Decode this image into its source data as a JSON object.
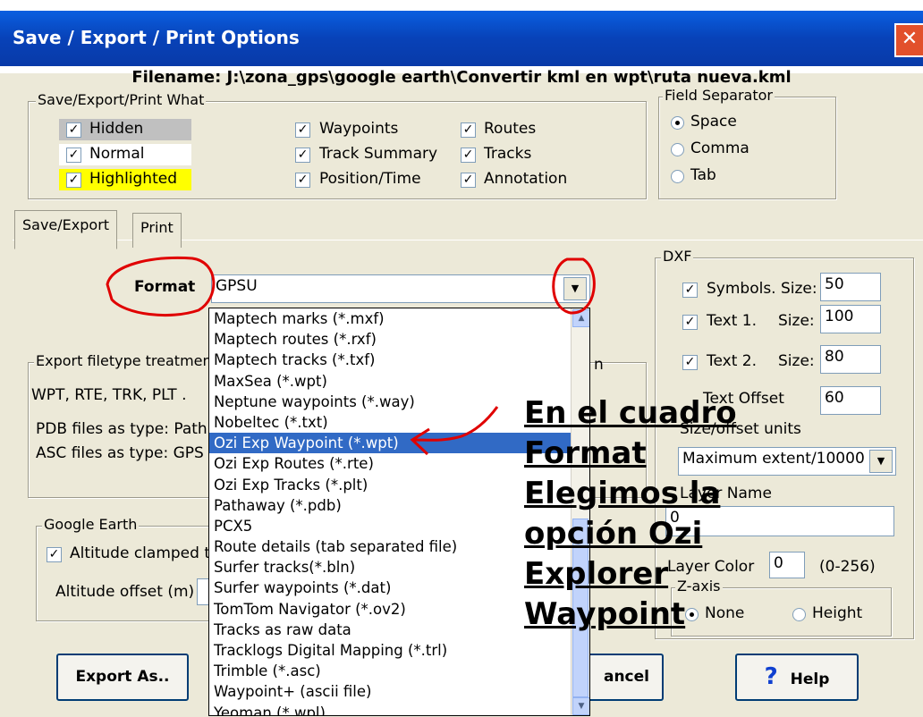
{
  "window": {
    "title": "Save / Export / Print Options",
    "close_glyph": "✕"
  },
  "filename": "Filename: J:\\zona_gps\\google earth\\Convertir kml en wpt\\ruta nueva.kml",
  "what_group": {
    "legend": "Save/Export/Print What",
    "col1": [
      {
        "label": "Hidden",
        "checked": true
      },
      {
        "label": "Normal",
        "checked": true
      },
      {
        "label": "Highlighted",
        "checked": true
      }
    ],
    "col2": [
      {
        "label": "Waypoints",
        "checked": true
      },
      {
        "label": "Track Summary",
        "checked": true
      },
      {
        "label": "Position/Time",
        "checked": true
      }
    ],
    "col3": [
      {
        "label": "Routes",
        "checked": true
      },
      {
        "label": "Tracks",
        "checked": true
      },
      {
        "label": "Annotation",
        "checked": true
      }
    ]
  },
  "separator_group": {
    "legend": "Field Separator",
    "options": [
      {
        "label": "Space",
        "selected": true
      },
      {
        "label": "Comma",
        "selected": false
      },
      {
        "label": "Tab",
        "selected": false
      }
    ]
  },
  "tabs": [
    "Save/Export",
    "Print"
  ],
  "format": {
    "label": "Format",
    "value": "GPSU"
  },
  "format_options": [
    "Maptech marks (*.mxf)",
    "Maptech routes (*.rxf)",
    "Maptech tracks (*.txf)",
    "MaxSea (*.wpt)",
    "Neptune waypoints (*.way)",
    "Nobeltec (*.txt)",
    "Ozi Exp  Waypoint (*.wpt)",
    "Ozi Exp  Routes (*.rte)",
    "Ozi Exp  Tracks (*.plt)",
    "Pathaway (*.pdb)",
    "PCX5",
    "Route details (tab separated file)",
    "Surfer tracks(*.bln)",
    "Surfer waypoints (*.dat)",
    "TomTom Navigator (*.ov2)",
    "Tracks as raw data",
    "Tracklogs Digital Mapping (*.trl)",
    "Trimble (*.asc)",
    "Waypoint+ (ascii file)",
    "Yeoman  (*.wpl)"
  ],
  "selected_option_index": 6,
  "export_group": {
    "legend": "Export filetype treatmen",
    "line1": "WPT, RTE, TRK, PLT .",
    "line2": "PDB files as type: Path",
    "line3": "ASC files as type: GPS",
    "trailing_n": "n"
  },
  "google_group": {
    "legend": "Google Earth",
    "checkbox_label": "Altitude clamped to",
    "offset_label": "Altitude offset (m)"
  },
  "dxf_group": {
    "legend": "DXF",
    "symbols_label": "Symbols. Size:",
    "symbols_value": "50",
    "text1_label": "Text 1.",
    "text1_size_label": "Size:",
    "text1_value": "100",
    "text2_label": "Text 2.",
    "text2_size_label": "Size:",
    "text2_value": "80",
    "text_offset_label": "Text Offset",
    "text_offset_value": "60",
    "units_label": "Size/offset units",
    "units_value": "Maximum extent/10000",
    "layer_name_label": "Layer Name",
    "layer_name_value": "0",
    "layer_color_label": "Layer Color",
    "layer_color_value": "0",
    "layer_color_range": "(0-256)",
    "zaxis_legend": "Z-axis",
    "zaxis_none": "None",
    "zaxis_height": "Height"
  },
  "buttons": {
    "export": "Export As..",
    "cancel": "ancel",
    "help": "Help",
    "help_glyph": "?"
  },
  "overlay_lines": [
    "En el cuadro",
    "Format",
    "Elegimos la",
    "opción Ozi",
    "Explorer",
    "Waypoint"
  ],
  "colors": {
    "highlight_yellow": "#ffff00",
    "selection_blue": "#316ac5",
    "annotation_red": "#e00000"
  }
}
